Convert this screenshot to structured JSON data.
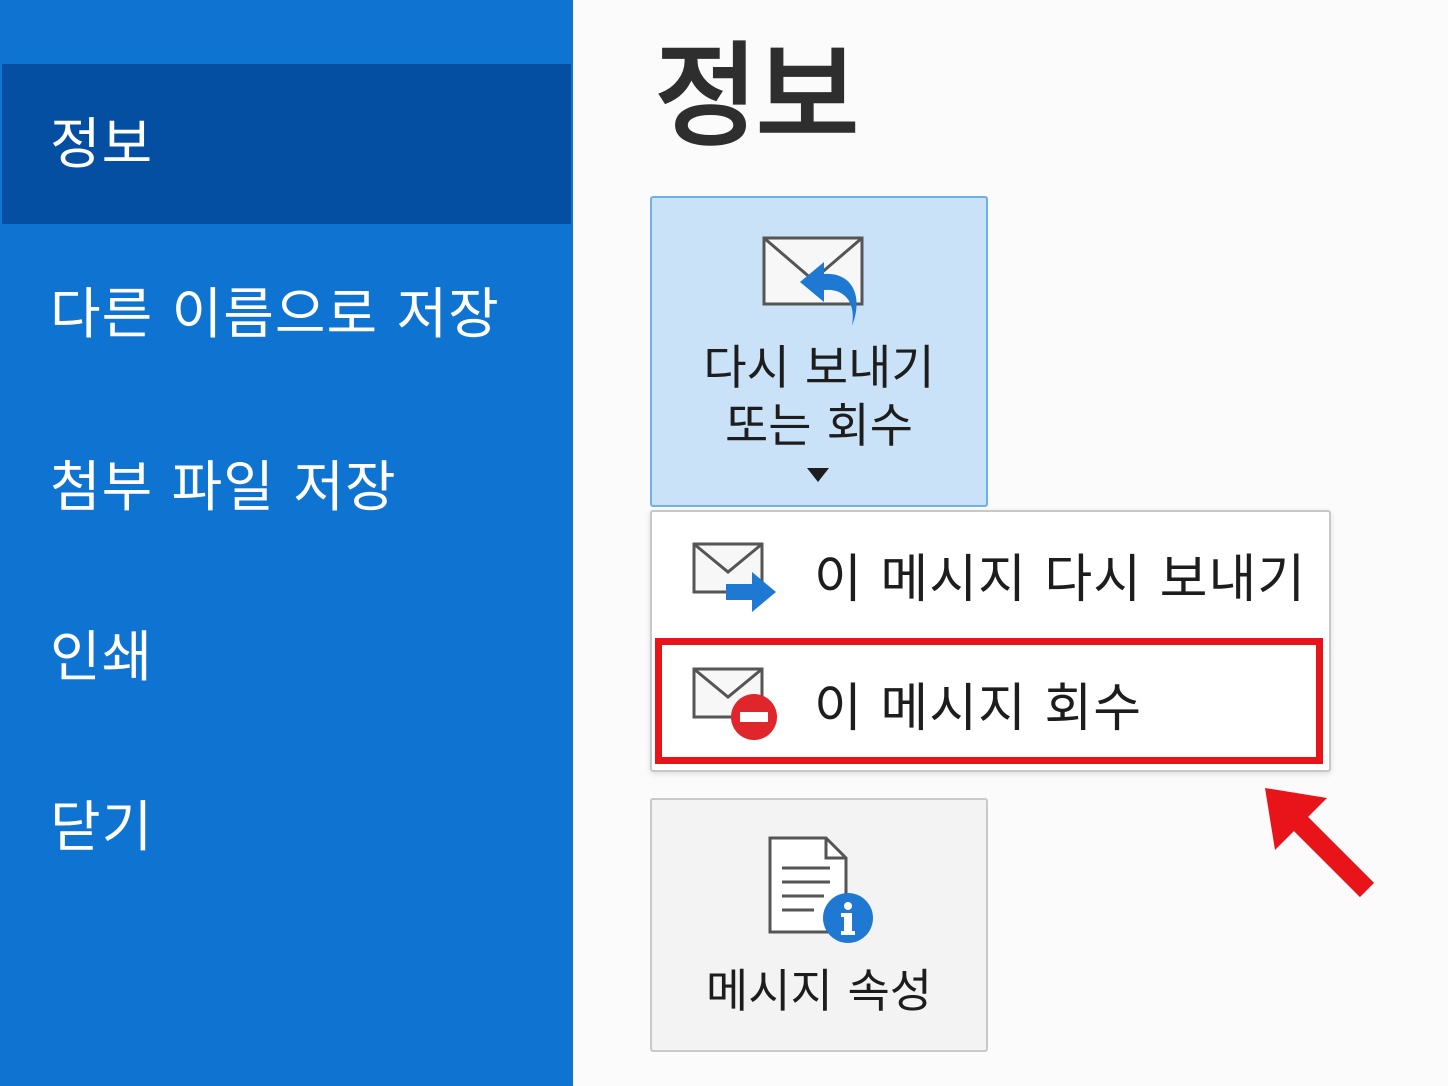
{
  "sidebar": {
    "items": [
      {
        "label": "정보",
        "active": true
      },
      {
        "label": "다른 이름으로 저장"
      },
      {
        "label": "첨부 파일 저장"
      },
      {
        "label": "인쇄"
      },
      {
        "label": "닫기"
      }
    ]
  },
  "main": {
    "title": "정보",
    "resend_button": {
      "line1": "다시 보내기",
      "line2": "또는 회수"
    },
    "dropdown": {
      "resend_label": "이 메시지 다시 보내기",
      "recall_label": "이 메시지 회수"
    },
    "properties_button": {
      "label": "메시지 속성"
    }
  },
  "colors": {
    "sidebar": "#0e73d1",
    "sidebar_active": "#054fa3",
    "highlight": "#e8141a",
    "accent_blue": "#1f78d1"
  }
}
